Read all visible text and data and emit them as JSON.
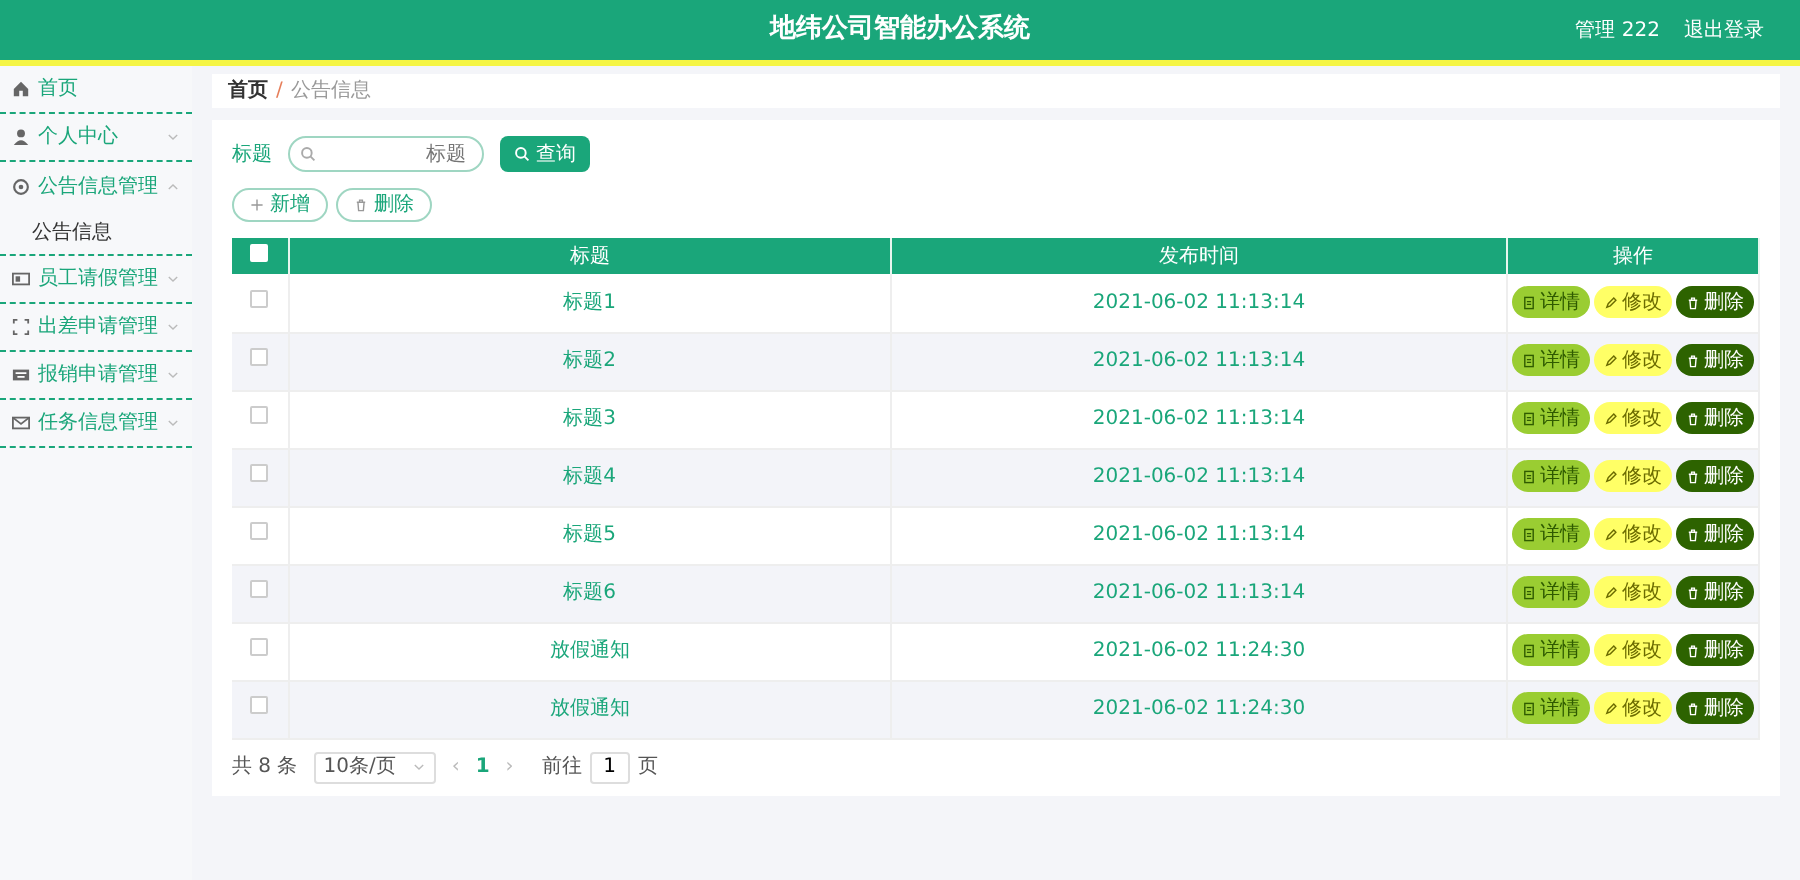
{
  "header": {
    "title": "地纬公司智能办公系统",
    "user": "管理 222",
    "logout": "退出登录"
  },
  "sidebar": {
    "items": [
      {
        "label": "首页",
        "kind": "link"
      },
      {
        "label": "个人中心",
        "kind": "menu",
        "expanded": false
      },
      {
        "label": "公告信息管理",
        "kind": "menu",
        "expanded": true,
        "children": [
          {
            "label": "公告信息"
          }
        ]
      },
      {
        "label": "员工请假管理",
        "kind": "menu",
        "expanded": false
      },
      {
        "label": "出差申请管理",
        "kind": "menu",
        "expanded": false
      },
      {
        "label": "报销申请管理",
        "kind": "menu",
        "expanded": false
      },
      {
        "label": "任务信息管理",
        "kind": "menu",
        "expanded": false
      }
    ]
  },
  "breadcrumb": {
    "home": "首页",
    "separator": "/",
    "current": "公告信息"
  },
  "search": {
    "label": "标题",
    "placeholder": "标题",
    "button": "查询"
  },
  "actions": [
    {
      "label": "新增",
      "kind": "add"
    },
    {
      "label": "删除",
      "kind": "delete"
    }
  ],
  "table": {
    "select_all": {
      "checked": false
    },
    "columns": [
      "标题",
      "发布时间",
      "操作"
    ],
    "rows": [
      {
        "checked": false,
        "title": "标题1",
        "time": "2021-06-02 11:13:14",
        "buttons": [
          {
            "label": "详情",
            "kind": "detail"
          },
          {
            "label": "修改",
            "kind": "edit"
          },
          {
            "label": "删除",
            "kind": "delete"
          }
        ]
      },
      {
        "checked": false,
        "title": "标题2",
        "time": "2021-06-02 11:13:14",
        "buttons": [
          {
            "label": "详情",
            "kind": "detail"
          },
          {
            "label": "修改",
            "kind": "edit"
          },
          {
            "label": "删除",
            "kind": "delete"
          }
        ]
      },
      {
        "checked": false,
        "title": "标题3",
        "time": "2021-06-02 11:13:14",
        "buttons": [
          {
            "label": "详情",
            "kind": "detail"
          },
          {
            "label": "修改",
            "kind": "edit"
          },
          {
            "label": "删除",
            "kind": "delete"
          }
        ]
      },
      {
        "checked": false,
        "title": "标题4",
        "time": "2021-06-02 11:13:14",
        "buttons": [
          {
            "label": "详情",
            "kind": "detail"
          },
          {
            "label": "修改",
            "kind": "edit"
          },
          {
            "label": "删除",
            "kind": "delete"
          }
        ]
      },
      {
        "checked": false,
        "title": "标题5",
        "time": "2021-06-02 11:13:14",
        "buttons": [
          {
            "label": "详情",
            "kind": "detail"
          },
          {
            "label": "修改",
            "kind": "edit"
          },
          {
            "label": "删除",
            "kind": "delete"
          }
        ]
      },
      {
        "checked": false,
        "title": "标题6",
        "time": "2021-06-02 11:13:14",
        "buttons": [
          {
            "label": "详情",
            "kind": "detail"
          },
          {
            "label": "修改",
            "kind": "edit"
          },
          {
            "label": "删除",
            "kind": "delete"
          }
        ]
      },
      {
        "checked": false,
        "title": "放假通知",
        "time": "2021-06-02 11:24:30",
        "buttons": [
          {
            "label": "详情",
            "kind": "detail"
          },
          {
            "label": "修改",
            "kind": "edit"
          },
          {
            "label": "删除",
            "kind": "delete"
          }
        ]
      },
      {
        "checked": false,
        "title": "放假通知",
        "time": "2021-06-02 11:24:30",
        "buttons": [
          {
            "label": "详情",
            "kind": "detail"
          },
          {
            "label": "修改",
            "kind": "edit"
          },
          {
            "label": "删除",
            "kind": "delete"
          }
        ]
      }
    ]
  },
  "pagination": {
    "total": "共 8 条",
    "page_size": "10条/页",
    "prev": "‹",
    "pages": [
      {
        "label": "1",
        "selected": true
      }
    ],
    "next": "›",
    "goto_label": "前往",
    "goto_value": "1",
    "goto_suffix": "页"
  }
}
